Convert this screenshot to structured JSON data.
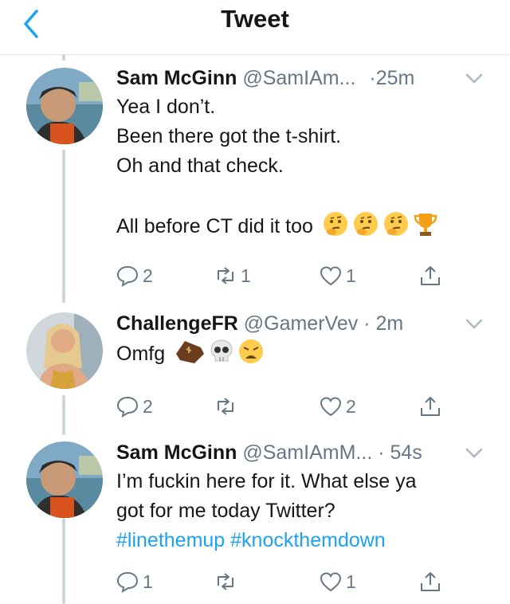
{
  "header": {
    "title": "Tweet"
  },
  "tweets": [
    {
      "name": "Sam McGinn",
      "handle": "@SamIAm...",
      "time": "·25m",
      "lines": [
        "Yea I don’t.",
        "Been there got the t-shirt.",
        "Oh and that check."
      ],
      "line2": "All before CT did it too",
      "emojis": [
        "thinking-face",
        "thinking-face",
        "thinking-face",
        "trophy"
      ],
      "reply_count": "2",
      "retweet_count": "1",
      "like_count": "1"
    },
    {
      "name": "ChallengeFR",
      "handle": "@GamerVev",
      "time": "· 2m",
      "lines": [
        "Omfg"
      ],
      "emojis": [
        "coffin",
        "skull",
        "weary-face"
      ],
      "reply_count": "2",
      "retweet_count": "",
      "like_count": "2"
    },
    {
      "name": "Sam McGinn",
      "handle": "@SamIAmM...",
      "time": "· 54s",
      "lines": [
        "I’m fuckin here for it. What else ya",
        "got for me today Twitter?"
      ],
      "hashtags": "#linethemup #knockthemdown",
      "reply_count": "1",
      "retweet_count": "",
      "like_count": "1"
    }
  ],
  "colors": {
    "accent": "#1da1f2",
    "muted": "#657786",
    "line": "#ccd6dd"
  }
}
